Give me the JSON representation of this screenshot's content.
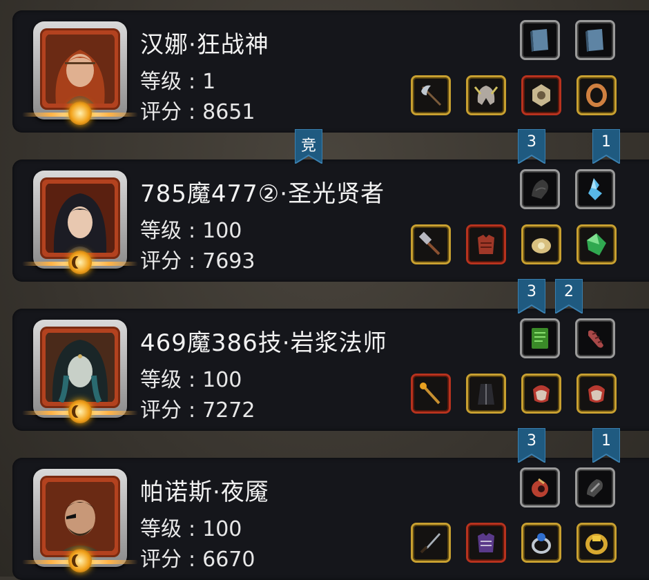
{
  "labels": {
    "level": "等级",
    "score": "评分",
    "colon": ":"
  },
  "players": [
    {
      "name": "汉娜·狂战神",
      "level": "1",
      "score": "8651",
      "emblem": "sun-emblem",
      "top_slots": [
        "book-icon",
        "book-icon"
      ],
      "bottom_slots": [
        "axe-icon",
        "helmet-icon",
        "amulet-icon",
        "ring-icon"
      ],
      "bottom_frames": [
        "gold",
        "gold",
        "red",
        "gold"
      ]
    },
    {
      "name": "785魔477②·圣光贤者",
      "level": "100",
      "score": "7693",
      "emblem": "moon-emblem",
      "top_slots": [
        "gauntlet-icon",
        "crystal-icon"
      ],
      "bottom_slots": [
        "hammer-icon",
        "armor-icon",
        "amulet-icon",
        "gem-icon"
      ],
      "bottom_frames": [
        "gold",
        "red",
        "gold",
        "gold"
      ]
    },
    {
      "name": "469魔386技·岩浆法师",
      "level": "100",
      "score": "7272",
      "emblem": "moon-emblem",
      "top_slots": [
        "spellbook-icon",
        "bracer-icon"
      ],
      "bottom_slots": [
        "staff-icon",
        "robe-icon",
        "glove-icon",
        "glove-icon"
      ],
      "bottom_frames": [
        "red",
        "gold",
        "gold",
        "gold"
      ]
    },
    {
      "name": "帕诺斯·夜魇",
      "level": "100",
      "score": "6670",
      "emblem": "moon-emblem",
      "top_slots": [
        "eye-icon",
        "bracer-icon"
      ],
      "bottom_slots": [
        "dagger-icon",
        "armor-icon",
        "ring-icon",
        "ring-icon"
      ],
      "bottom_frames": [
        "gold",
        "red",
        "gold",
        "gold"
      ]
    }
  ],
  "ribbons": [
    {
      "text": "竞"
    },
    {
      "text": "3"
    },
    {
      "text": "1"
    },
    {
      "text": "3"
    },
    {
      "text": "2"
    },
    {
      "text": "3"
    },
    {
      "text": "1"
    }
  ],
  "colors": {
    "card": "#15161b",
    "ribbon": "#1f5a80",
    "gold_frame": "#c8a030",
    "red_frame": "#b8321e",
    "portrait_red": "#b3421f"
  }
}
